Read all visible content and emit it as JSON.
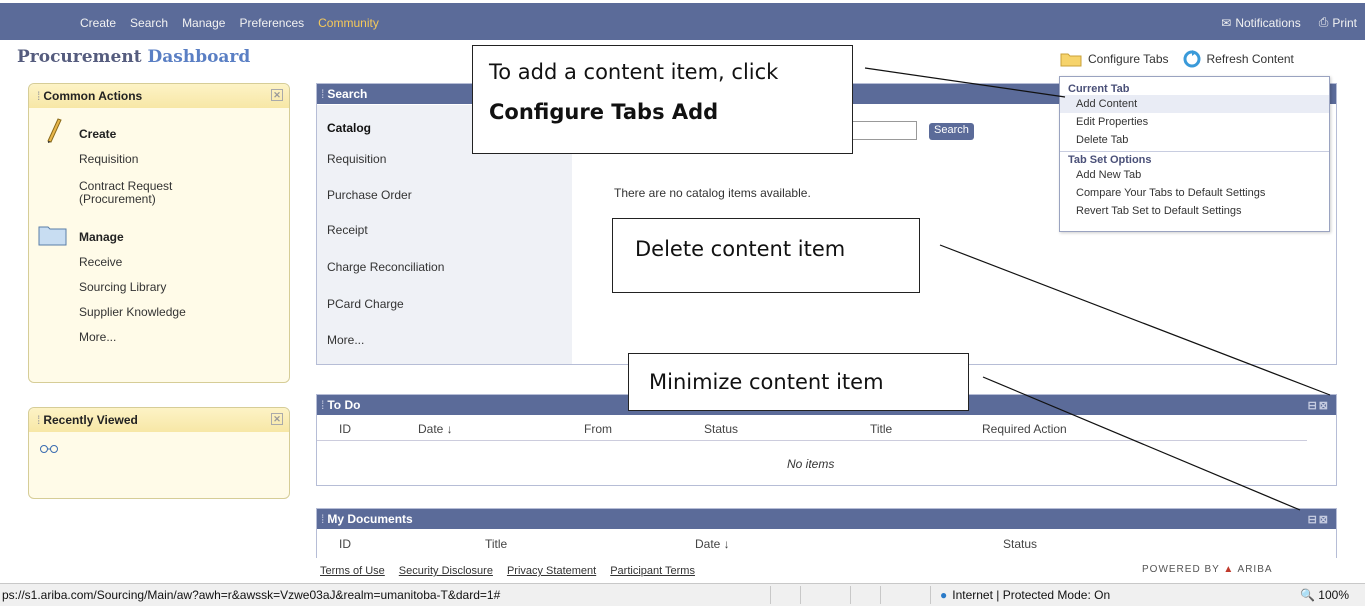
{
  "nav": {
    "menu": [
      "Create",
      "Search",
      "Manage",
      "Preferences",
      "Community"
    ],
    "notifications": "Notifications",
    "print": "Print"
  },
  "page_title": {
    "part1": "Procurement",
    "part2": "Dashboard"
  },
  "config": {
    "configure_tabs": "Configure Tabs",
    "refresh_content": "Refresh Content"
  },
  "common_actions": {
    "title": "Common Actions",
    "create_title": "Create",
    "create_items": [
      "Requisition",
      "Contract Request",
      "(Procurement)"
    ],
    "manage_title": "Manage",
    "manage_items": [
      "Receive",
      "Sourcing Library",
      "Supplier Knowledge",
      "More..."
    ]
  },
  "recently_viewed": {
    "title": "Recently Viewed"
  },
  "search": {
    "title": "Search",
    "tabs": [
      "Catalog",
      "Requisition",
      "Purchase Order",
      "Receipt",
      "Charge Reconciliation",
      "PCard Charge",
      "More..."
    ],
    "button": "Search",
    "empty_message": "There are no catalog items available."
  },
  "todo": {
    "title": "To Do",
    "columns": [
      "ID",
      "Date ↓",
      "From",
      "Status",
      "Title",
      "Required Action"
    ],
    "empty": "No items"
  },
  "my_documents": {
    "title": "My Documents",
    "columns": [
      "ID",
      "Title",
      "Date ↓",
      "Status"
    ]
  },
  "dropdown": {
    "current_tab": "Current Tab",
    "current_items": [
      "Add Content",
      "Edit Properties",
      "Delete Tab"
    ],
    "tabset_title": "Tab Set Options",
    "tabset_items": [
      "Add New Tab",
      "Compare Your Tabs to Default Settings",
      "Revert Tab Set to Default Settings"
    ]
  },
  "callouts": {
    "add_line1": "To add a content item, click",
    "add_line2": "Configure Tabs Add",
    "delete": "Delete content item",
    "minimize": "Minimize content item"
  },
  "footer": {
    "links": [
      "Terms of Use",
      "Security Disclosure",
      "Privacy Statement",
      "Participant Terms"
    ],
    "powered_by": "POWERED BY",
    "ariba": "ARIBA"
  },
  "statusbar": {
    "url": "ps://s1.ariba.com/Sourcing/Main/aw?awh=r&awssk=Vzwe03aJ&realm=umanitoba-T&dard=1#",
    "zone": "Internet | Protected Mode: On",
    "zoom": "100%"
  },
  "colors": {
    "nav": "#5b6b99",
    "portlet_header": "#5b6b99",
    "yellow_portlet": "#fffbe8",
    "active_menu": "#f5c95a"
  }
}
